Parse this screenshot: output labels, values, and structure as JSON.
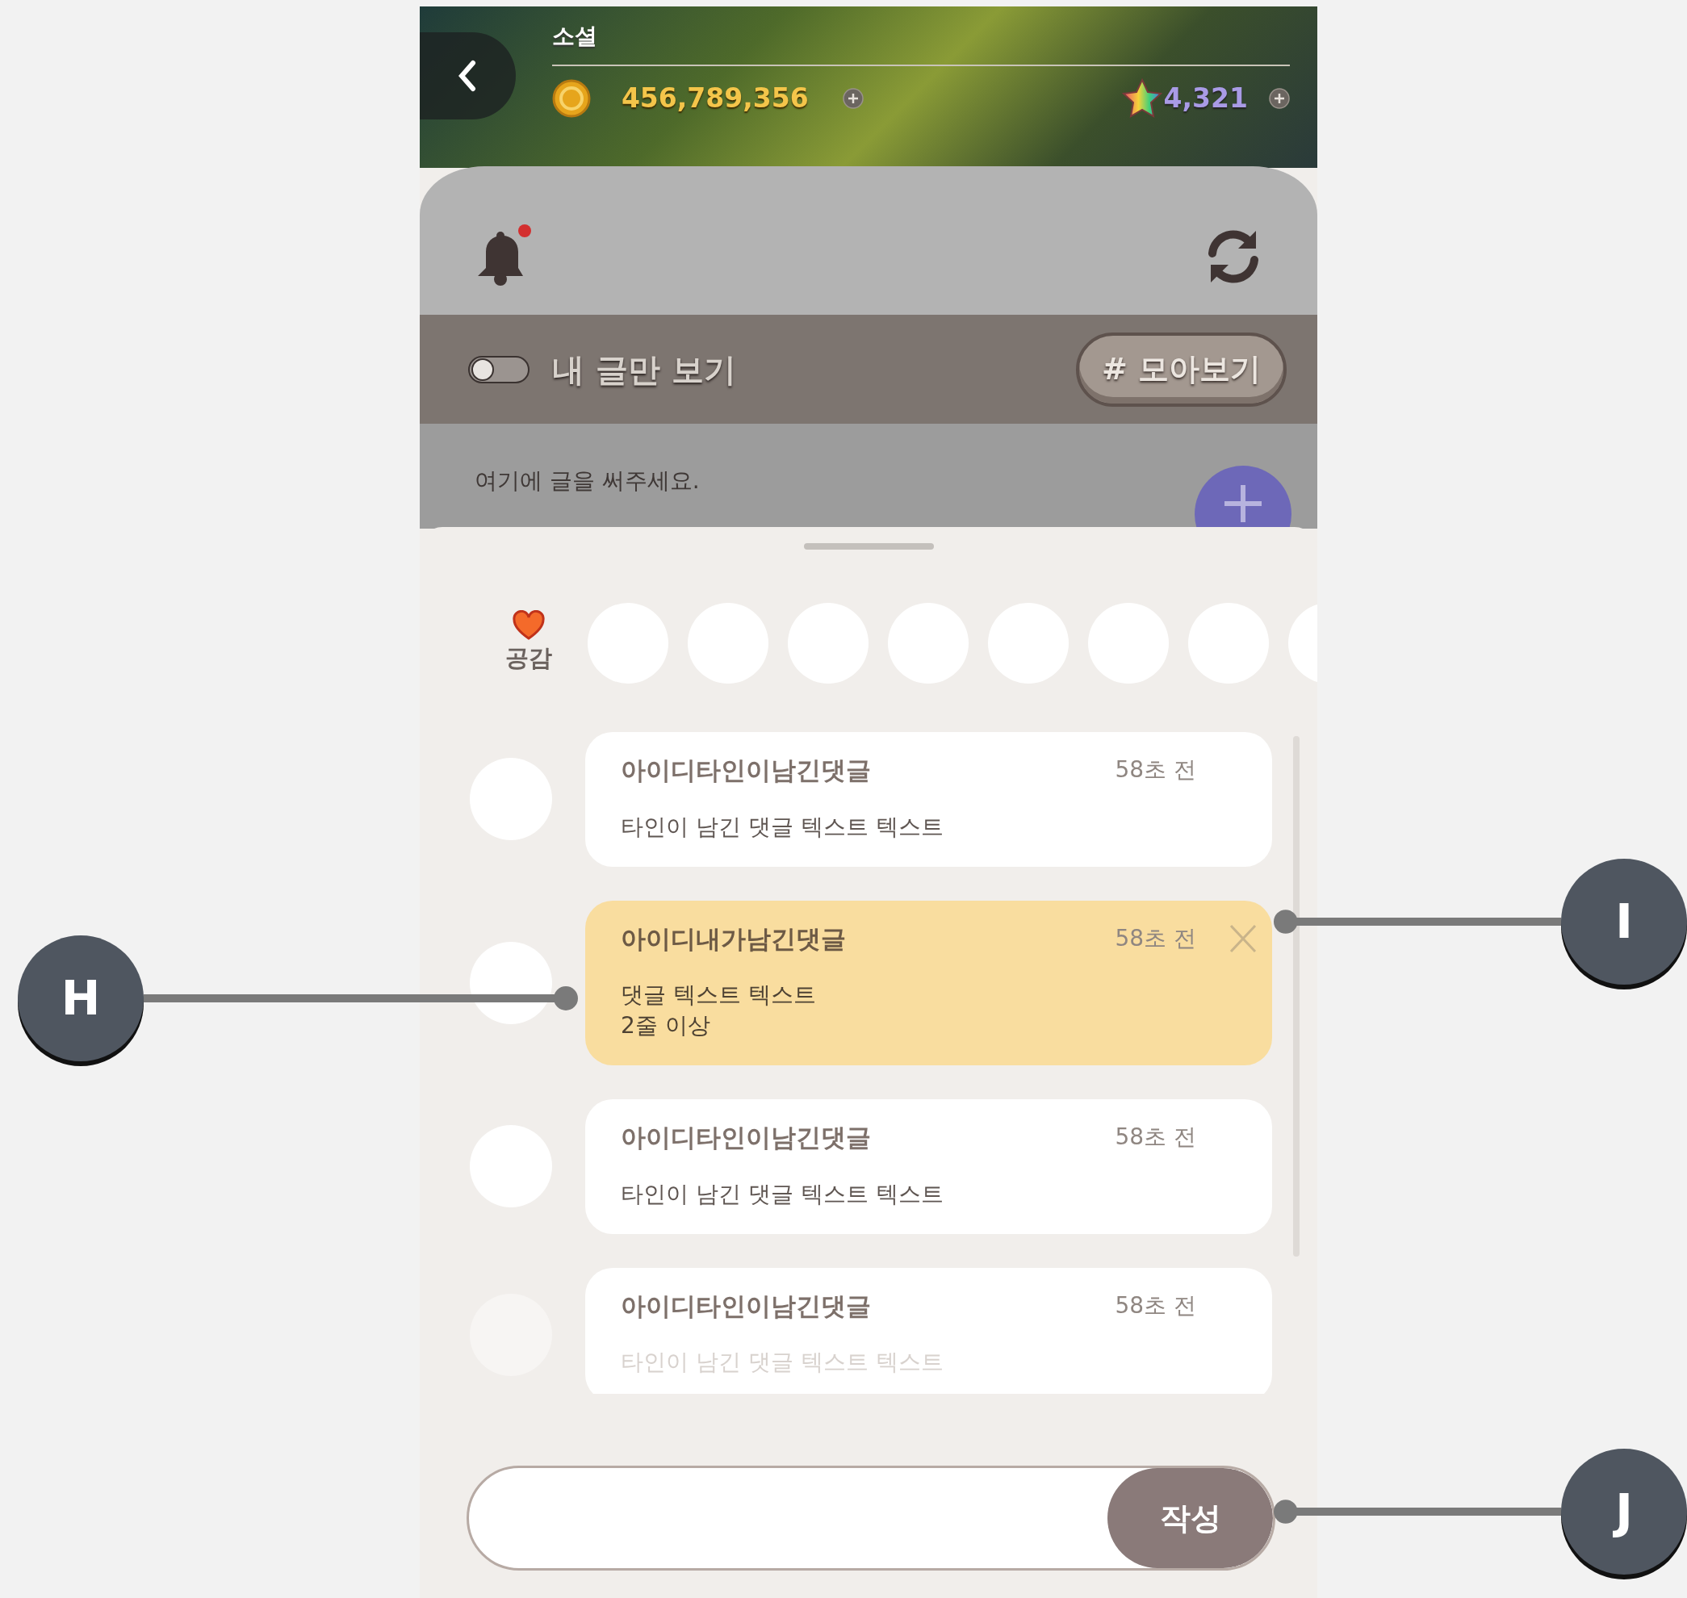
{
  "header": {
    "title": "소셜",
    "coins": "456,789,356",
    "gems": "4,321"
  },
  "toolbar": {
    "unread": true
  },
  "filter": {
    "toggle_label": "내 글만 보기",
    "on": false,
    "collect_button": "# 모아보기"
  },
  "composer": {
    "placeholder": "여기에 글을 써주세요."
  },
  "reactions": {
    "label": "공감"
  },
  "comments": [
    {
      "author": "아이디타인이남긴댓글",
      "time": "58초 전",
      "lines": [
        "타인이 남긴 댓글 텍스트 텍스트"
      ],
      "mine": false,
      "faded": false
    },
    {
      "author": "아이디내가남긴댓글",
      "time": "58초 전",
      "lines": [
        "댓글 텍스트 텍스트",
        "2줄 이상"
      ],
      "mine": true,
      "faded": false
    },
    {
      "author": "아이디타인이남긴댓글",
      "time": "58초 전",
      "lines": [
        "타인이 남긴 댓글 텍스트 텍스트"
      ],
      "mine": false,
      "faded": false
    },
    {
      "author": "아이디타인이남긴댓글",
      "time": "58초 전",
      "lines": [
        "타인이 남긴 댓글 텍스트 텍스트"
      ],
      "mine": false,
      "faded": true
    }
  ],
  "input": {
    "submit": "작성"
  },
  "annotations": [
    {
      "label": "H"
    },
    {
      "label": "I"
    },
    {
      "label": "J"
    }
  ]
}
